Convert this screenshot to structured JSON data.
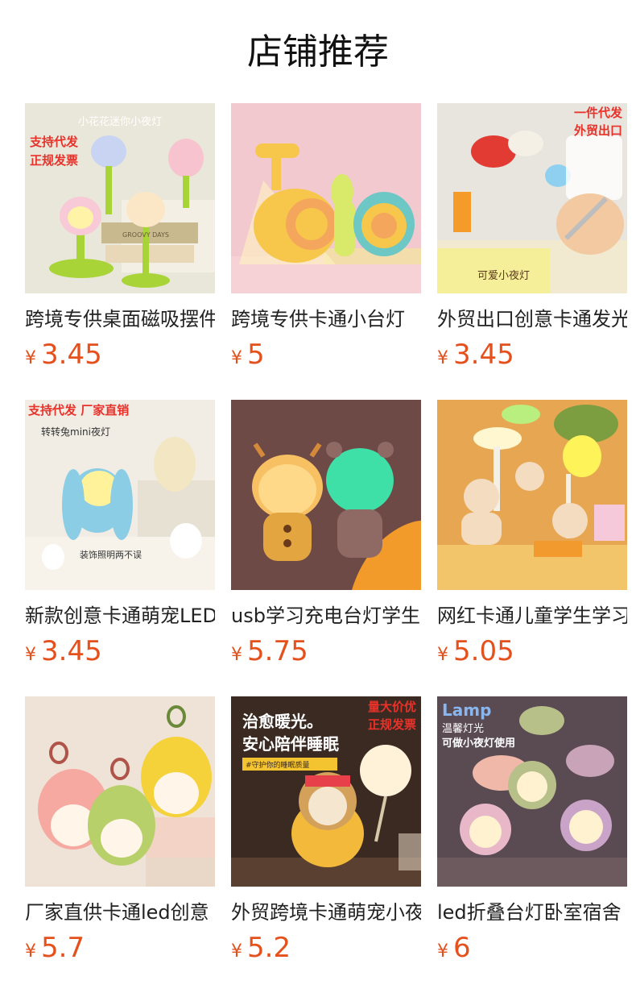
{
  "header": {
    "title": "店铺推荐"
  },
  "products": [
    {
      "name": "跨境专供桌面磁吸摆件",
      "currency": "¥",
      "price": "3.45",
      "overlay": [
        "小花花迷你小夜灯",
        "支持代发",
        "正规发票",
        "GROOVY DAYS"
      ]
    },
    {
      "name": "跨境专供卡通小台灯",
      "currency": "¥",
      "price": "5",
      "overlay": []
    },
    {
      "name": "外贸出口创意卡通发光",
      "currency": "¥",
      "price": "3.45",
      "overlay": [
        "一件代发",
        "外贸出口",
        "可爱小夜灯"
      ]
    },
    {
      "name": "新款创意卡通萌宠LED",
      "currency": "¥",
      "price": "3.45",
      "overlay": [
        "支持代发  厂家直销",
        "转转兔mini夜灯",
        "装饰照明两不误"
      ]
    },
    {
      "name": "usb学习充电台灯学生",
      "currency": "¥",
      "price": "5.75",
      "overlay": []
    },
    {
      "name": "网红卡通儿童学生学习",
      "currency": "¥",
      "price": "5.05",
      "overlay": []
    },
    {
      "name": "厂家直供卡通led创意",
      "currency": "¥",
      "price": "5.7",
      "overlay": []
    },
    {
      "name": "外贸跨境卡通萌宠小夜",
      "currency": "¥",
      "price": "5.2",
      "overlay": [
        "治愈暖光。",
        "安心陪伴睡眠",
        "量大价优",
        "正规发票",
        "#守护你的睡眠质量"
      ]
    },
    {
      "name": "led折叠台灯卧室宿舍",
      "currency": "¥",
      "price": "6",
      "overlay": [
        "Lamp",
        "温馨灯光",
        "可做小夜灯使用"
      ]
    }
  ]
}
